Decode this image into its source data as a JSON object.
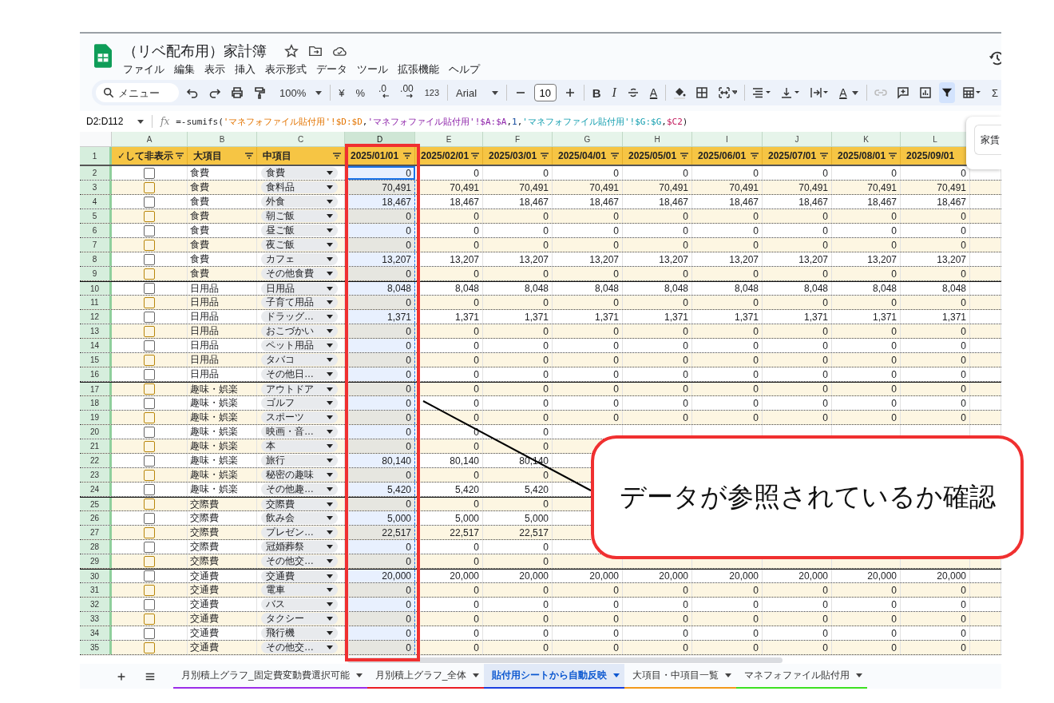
{
  "document": {
    "title": "（リベ配布用）家計簿"
  },
  "menu": [
    "ファイル",
    "編集",
    "表示",
    "挿入",
    "表示形式",
    "データ",
    "ツール",
    "拡張機能",
    "ヘルプ"
  ],
  "toolbar": {
    "search_placeholder": "メニュー",
    "zoom": "100%",
    "currency": "¥",
    "percent": "%",
    "decrease_decimals": ".0",
    "increase_decimals": ".00",
    "number_format": "123",
    "font": "Arial",
    "font_size": "10",
    "bold": "B",
    "italic": "I",
    "text_color": "A",
    "text_rotation": "A",
    "sum": "Σ",
    "filter_on": true
  },
  "formula_bar": {
    "range": "D2:D112",
    "fx": "fx",
    "parts": [
      {
        "text": "=-sumifs("
      },
      {
        "text": "'マネフォファイル貼付用'!$D:$D",
        "color": "#e37400"
      },
      {
        "text": ","
      },
      {
        "text": "'マネフォファイル貼付用'!$A:$A",
        "color": "#8e24aa"
      },
      {
        "text": ","
      },
      {
        "text": "1",
        "color": "#1a4fa0"
      },
      {
        "text": ","
      },
      {
        "text": "'マネフォファイル貼付用'!$G:$G",
        "color": "#129eaf"
      },
      {
        "text": ","
      },
      {
        "text": "$C2",
        "color": "#c2185b"
      },
      {
        "text": ")"
      }
    ]
  },
  "side_panel": {
    "value": "家賃"
  },
  "sheet": {
    "columns": [
      {
        "letter": "A",
        "selected": false
      },
      {
        "letter": "B",
        "selected": false
      },
      {
        "letter": "C",
        "selected": false
      },
      {
        "letter": "D",
        "selected": true
      },
      {
        "letter": "E",
        "selected": false
      },
      {
        "letter": "F",
        "selected": false
      },
      {
        "letter": "G",
        "selected": false
      },
      {
        "letter": "H",
        "selected": false
      },
      {
        "letter": "I",
        "selected": false
      },
      {
        "letter": "J",
        "selected": false
      },
      {
        "letter": "K",
        "selected": false
      },
      {
        "letter": "L",
        "selected": false
      }
    ],
    "header_row": {
      "number": "1",
      "check": "✓",
      "cells": [
        "して非表示",
        "大項目",
        "中項目",
        "2025/01/01",
        "2025/02/01",
        "2025/03/01",
        "2025/04/01",
        "2025/05/01",
        "2025/06/01",
        "2025/07/01",
        "2025/08/01",
        "2025/09/01"
      ]
    },
    "rows": [
      {
        "number": "2",
        "checked": false,
        "category": "食費",
        "item": "食費",
        "values": [
          "0",
          "0",
          "0",
          "0",
          "0",
          "0",
          "0",
          "0",
          "0"
        ]
      },
      {
        "number": "3",
        "checked": false,
        "category": "食費",
        "item": "食料品",
        "values": [
          "70,491",
          "70,491",
          "70,491",
          "70,491",
          "70,491",
          "70,491",
          "70,491",
          "70,491",
          "70,491"
        ]
      },
      {
        "number": "4",
        "checked": false,
        "category": "食費",
        "item": "外食",
        "values": [
          "18,467",
          "18,467",
          "18,467",
          "18,467",
          "18,467",
          "18,467",
          "18,467",
          "18,467",
          "18,467"
        ]
      },
      {
        "number": "5",
        "checked": false,
        "category": "食費",
        "item": "朝ご飯",
        "values": [
          "0",
          "0",
          "0",
          "0",
          "0",
          "0",
          "0",
          "0",
          "0"
        ]
      },
      {
        "number": "6",
        "checked": false,
        "category": "食費",
        "item": "昼ご飯",
        "values": [
          "0",
          "0",
          "0",
          "0",
          "0",
          "0",
          "0",
          "0",
          "0"
        ]
      },
      {
        "number": "7",
        "checked": false,
        "category": "食費",
        "item": "夜ご飯",
        "values": [
          "0",
          "0",
          "0",
          "0",
          "0",
          "0",
          "0",
          "0",
          "0"
        ]
      },
      {
        "number": "8",
        "checked": false,
        "category": "食費",
        "item": "カフェ",
        "values": [
          "13,207",
          "13,207",
          "13,207",
          "13,207",
          "13,207",
          "13,207",
          "13,207",
          "13,207",
          "13,207"
        ]
      },
      {
        "number": "9",
        "checked": false,
        "category": "食費",
        "item": "その他食費",
        "values": [
          "0",
          "0",
          "0",
          "0",
          "0",
          "0",
          "0",
          "0",
          "0"
        ]
      },
      {
        "number": "10",
        "checked": false,
        "category": "日用品",
        "item": "日用品",
        "values": [
          "8,048",
          "8,048",
          "8,048",
          "8,048",
          "8,048",
          "8,048",
          "8,048",
          "8,048",
          "8,048"
        ]
      },
      {
        "number": "11",
        "checked": false,
        "category": "日用品",
        "item": "子育て用品",
        "values": [
          "0",
          "0",
          "0",
          "0",
          "0",
          "0",
          "0",
          "0",
          "0"
        ]
      },
      {
        "number": "12",
        "checked": false,
        "category": "日用品",
        "item": "ドラッグ…",
        "values": [
          "1,371",
          "1,371",
          "1,371",
          "1,371",
          "1,371",
          "1,371",
          "1,371",
          "1,371",
          "1,371"
        ]
      },
      {
        "number": "13",
        "checked": false,
        "category": "日用品",
        "item": "おこづかい",
        "values": [
          "0",
          "0",
          "0",
          "0",
          "0",
          "0",
          "0",
          "0",
          "0"
        ]
      },
      {
        "number": "14",
        "checked": false,
        "category": "日用品",
        "item": "ペット用品",
        "values": [
          "0",
          "0",
          "0",
          "0",
          "0",
          "0",
          "0",
          "0",
          "0"
        ]
      },
      {
        "number": "15",
        "checked": false,
        "category": "日用品",
        "item": "タバコ",
        "values": [
          "0",
          "0",
          "0",
          "0",
          "0",
          "0",
          "0",
          "0",
          "0"
        ]
      },
      {
        "number": "16",
        "checked": false,
        "category": "日用品",
        "item": "その他日…",
        "values": [
          "0",
          "0",
          "0",
          "0",
          "0",
          "0",
          "0",
          "0",
          "0"
        ]
      },
      {
        "number": "17",
        "checked": false,
        "category": "趣味・娯楽",
        "item": "アウトドア",
        "values": [
          "0",
          "0",
          "0",
          "0",
          "0",
          "0",
          "0",
          "0",
          "0"
        ]
      },
      {
        "number": "18",
        "checked": false,
        "category": "趣味・娯楽",
        "item": "ゴルフ",
        "values": [
          "0",
          "0",
          "0",
          "0",
          "0",
          "0",
          "0",
          "0",
          "0"
        ]
      },
      {
        "number": "19",
        "checked": false,
        "category": "趣味・娯楽",
        "item": "スポーツ",
        "values": [
          "0",
          "0",
          "0",
          "0",
          "0",
          "0",
          "0",
          "0",
          "0"
        ]
      },
      {
        "number": "20",
        "checked": false,
        "category": "趣味・娯楽",
        "item": "映画・音…",
        "values": [
          "0",
          "0",
          "0"
        ]
      },
      {
        "number": "21",
        "checked": false,
        "category": "趣味・娯楽",
        "item": "本",
        "values": [
          "0",
          "0",
          "0"
        ]
      },
      {
        "number": "22",
        "checked": false,
        "category": "趣味・娯楽",
        "item": "旅行",
        "values": [
          "80,140",
          "80,140",
          "80,140"
        ]
      },
      {
        "number": "23",
        "checked": false,
        "category": "趣味・娯楽",
        "item": "秘密の趣味",
        "values": [
          "0",
          "0",
          "0"
        ]
      },
      {
        "number": "24",
        "checked": false,
        "category": "趣味・娯楽",
        "item": "その他趣…",
        "values": [
          "5,420",
          "5,420",
          "5,420"
        ]
      },
      {
        "number": "25",
        "checked": false,
        "category": "交際費",
        "item": "交際費",
        "values": [
          "0",
          "0",
          "0"
        ]
      },
      {
        "number": "26",
        "checked": false,
        "category": "交際費",
        "item": "飲み会",
        "values": [
          "5,000",
          "5,000",
          "5,000"
        ]
      },
      {
        "number": "27",
        "checked": false,
        "category": "交際費",
        "item": "プレゼン…",
        "values": [
          "22,517",
          "22,517",
          "22,517"
        ]
      },
      {
        "number": "28",
        "checked": false,
        "category": "交際費",
        "item": "冠婚葬祭",
        "values": [
          "0",
          "0",
          "0"
        ]
      },
      {
        "number": "29",
        "checked": false,
        "category": "交際費",
        "item": "その他交…",
        "values": [
          "0",
          "0",
          "0"
        ]
      },
      {
        "number": "30",
        "checked": false,
        "category": "交通費",
        "item": "交通費",
        "values": [
          "20,000",
          "20,000",
          "20,000",
          "20,000",
          "20,000",
          "20,000",
          "20,000",
          "20,000",
          "20,000"
        ]
      },
      {
        "number": "31",
        "checked": false,
        "category": "交通費",
        "item": "電車",
        "values": [
          "0",
          "0",
          "0",
          "0",
          "0",
          "0",
          "0",
          "0",
          "0"
        ]
      },
      {
        "number": "32",
        "checked": false,
        "category": "交通費",
        "item": "バス",
        "values": [
          "0",
          "0",
          "0",
          "0",
          "0",
          "0",
          "0",
          "0",
          "0"
        ]
      },
      {
        "number": "33",
        "checked": false,
        "category": "交通費",
        "item": "タクシー",
        "values": [
          "0",
          "0",
          "0",
          "0",
          "0",
          "0",
          "0",
          "0",
          "0"
        ]
      },
      {
        "number": "34",
        "checked": false,
        "category": "交通費",
        "item": "飛行機",
        "values": [
          "0",
          "0",
          "0",
          "0",
          "0",
          "0",
          "0",
          "0",
          "0"
        ]
      },
      {
        "number": "35",
        "checked": false,
        "category": "交通費",
        "item": "その他交…",
        "values": [
          "0",
          "0",
          "0",
          "0",
          "0",
          "0",
          "0",
          "0",
          "0"
        ]
      }
    ]
  },
  "sheet_tabs": [
    {
      "label": "月別積上グラフ_固定費変動費選択可能",
      "color": "#9b2ce8",
      "selected": false
    },
    {
      "label": "月別積上グラフ_全体",
      "color": "#ea1c24",
      "selected": false
    },
    {
      "label": "貼付用シートから自動反映",
      "color": "#1a3fe0",
      "selected": true
    },
    {
      "label": "大項目・中項目一覧",
      "color": "#f29a1a",
      "selected": false
    },
    {
      "label": "マネフォファイル貼付用",
      "color": "#3be021",
      "selected": false
    }
  ],
  "annotation": {
    "callout": "データが参照されているか確認"
  }
}
